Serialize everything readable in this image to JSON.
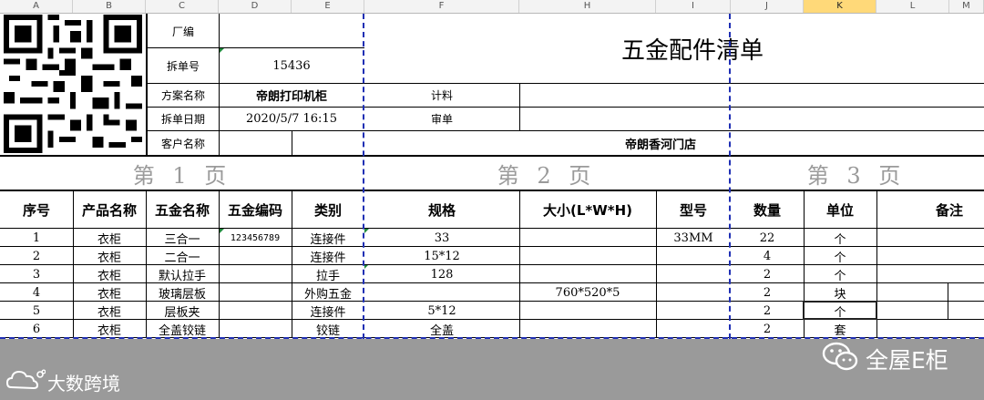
{
  "columns": [
    "A",
    "B",
    "C",
    "D",
    "E",
    "F",
    "H",
    "I",
    "J",
    "K",
    "L",
    "M"
  ],
  "selected_column": "K",
  "header_block": {
    "title": "五金配件清单",
    "factory_label": "厂编",
    "factory_value": "",
    "order_no_label": "拆单号",
    "order_no_value": "15436",
    "plan_label": "方案名称",
    "plan_value": "帝朗打印机柜",
    "date_label": "拆单日期",
    "date_value": "2020/5/7  16:15",
    "customer_label": "客户名称",
    "customer_value": "",
    "costing_label": "计料",
    "review_label": "审单",
    "store_value": "帝朗香河门店"
  },
  "pages": [
    "第 1 页",
    "第 2 页",
    "第 3 页"
  ],
  "table_headers": [
    "序号",
    "产品名称",
    "五金名称",
    "五金编码",
    "类别",
    "规格",
    "大小(L*W*H)",
    "型号",
    "数量",
    "单位",
    "备注"
  ],
  "rows": [
    {
      "no": "1",
      "product": "衣柜",
      "name": "三合一",
      "code": "123456789",
      "type": "连接件",
      "spec": "33",
      "size": "",
      "model": "33MM",
      "qty": "22",
      "unit": "个",
      "note": ""
    },
    {
      "no": "2",
      "product": "衣柜",
      "name": "二合一",
      "code": "",
      "type": "连接件",
      "spec": "15*12",
      "size": "",
      "model": "",
      "qty": "4",
      "unit": "个",
      "note": ""
    },
    {
      "no": "3",
      "product": "衣柜",
      "name": "默认拉手",
      "code": "",
      "type": "拉手",
      "spec": "128",
      "size": "",
      "model": "",
      "qty": "2",
      "unit": "个",
      "note": ""
    },
    {
      "no": "4",
      "product": "衣柜",
      "name": "玻璃层板",
      "code": "",
      "type": "外购五金",
      "spec": "",
      "size": "760*520*5",
      "model": "",
      "qty": "2",
      "unit": "块",
      "note": ""
    },
    {
      "no": "5",
      "product": "衣柜",
      "name": "层板夹",
      "code": "",
      "type": "连接件",
      "spec": "5*12",
      "size": "",
      "model": "",
      "qty": "2",
      "unit": "个",
      "note": ""
    },
    {
      "no": "6",
      "product": "衣柜",
      "name": "全盖铰链",
      "code": "",
      "type": "铰链",
      "spec": "全盖",
      "size": "",
      "model": "",
      "qty": "2",
      "unit": "套",
      "note": ""
    }
  ],
  "watermark_left": "大数跨境",
  "watermark_right": "全屋E柜",
  "colors": {
    "page_break": "#1f2fb4",
    "selected_header": "#ffd979",
    "grey_area": "#9a9a9a"
  },
  "icons": [
    "qr-code-icon",
    "logo-cloud-icon",
    "wechat-icon"
  ]
}
